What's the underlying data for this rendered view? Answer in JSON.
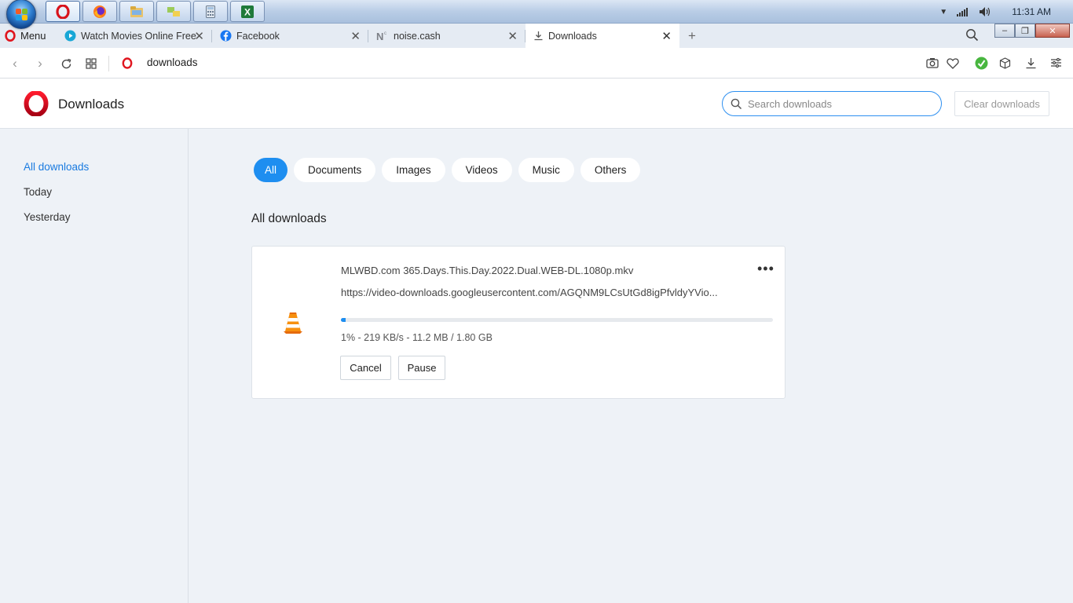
{
  "taskbar": {
    "apps": [
      "opera-app-icon",
      "firefox-app-icon",
      "file-explorer-app-icon",
      "network-app-icon",
      "calculator-app-icon",
      "excel-app-icon"
    ],
    "clock": "11:31 AM"
  },
  "browser": {
    "menu_label": "Menu",
    "tabs": [
      {
        "title": "Watch Movies Online Free",
        "icon": "play-icon"
      },
      {
        "title": "Facebook",
        "icon": "facebook-icon"
      },
      {
        "title": "noise.cash",
        "icon": "noise-cash-icon"
      },
      {
        "title": "Downloads",
        "icon": "download-icon",
        "active": true
      }
    ],
    "address": "downloads"
  },
  "header": {
    "title": "Downloads",
    "search_placeholder": "Search downloads",
    "clear_label": "Clear downloads"
  },
  "sidebar": {
    "items": [
      {
        "label": "All downloads",
        "active": true
      },
      {
        "label": "Today"
      },
      {
        "label": "Yesterday"
      }
    ]
  },
  "filters": [
    "All",
    "Documents",
    "Images",
    "Videos",
    "Music",
    "Others"
  ],
  "section_title": "All downloads",
  "download": {
    "filename": "MLWBD.com 365.Days.This.Day.2022.Dual.WEB-DL.1080p.mkv",
    "url": "https://video-downloads.googleusercontent.com/AGQNM9LCsUtGd8igPfvldyYVio...",
    "progress_percent": 1,
    "status": "1% - 219 KB/s - 11.2 MB / 1.80 GB",
    "cancel_label": "Cancel",
    "pause_label": "Pause",
    "file_icon": "vlc-cone-icon"
  },
  "colors": {
    "accent": "#1e8ef0",
    "opera_red": "#e0161f",
    "page_bg": "#eef2f7"
  }
}
